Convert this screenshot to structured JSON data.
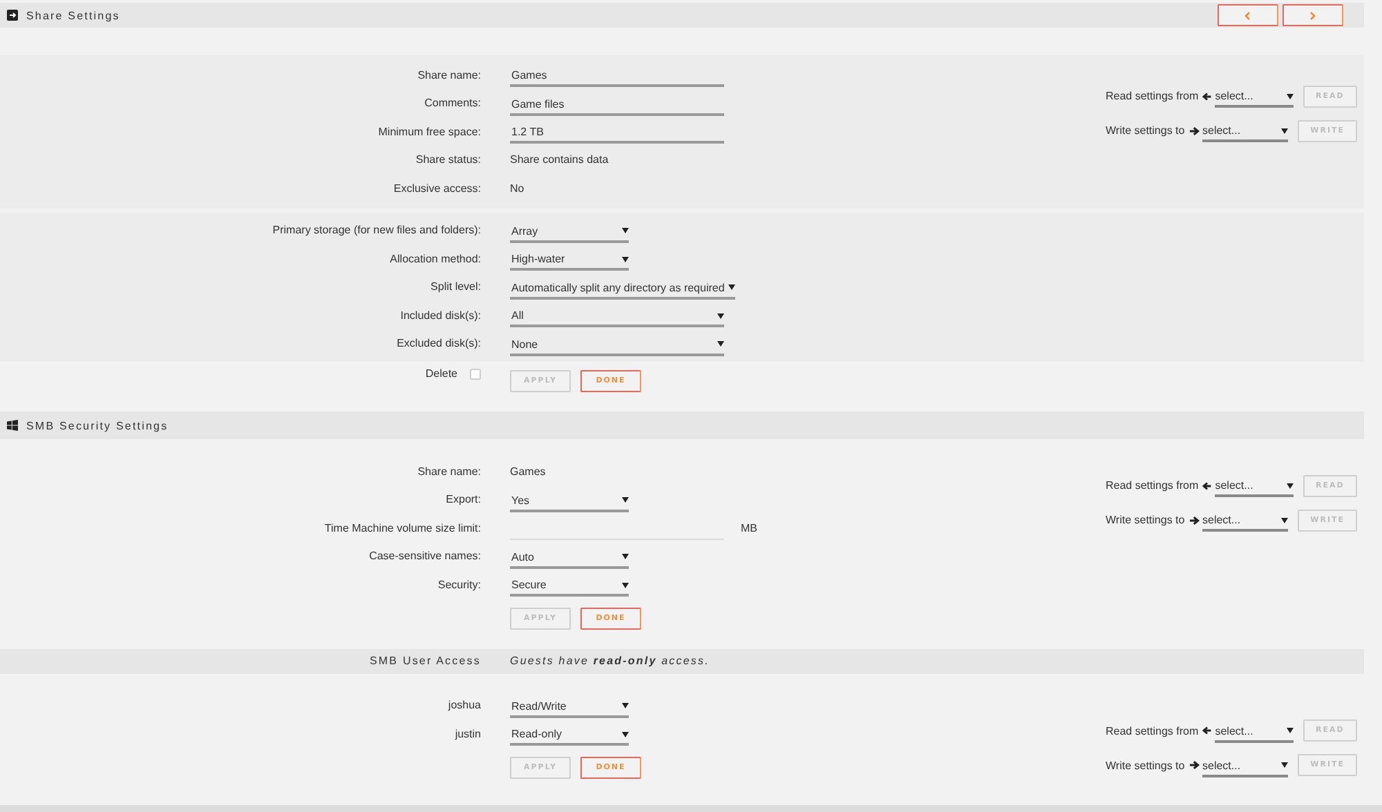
{
  "share_settings": {
    "title": "Share Settings",
    "navigation": true,
    "general": [
      {
        "label": "Share name:",
        "kind": "text",
        "value": "Games"
      },
      {
        "label": "Comments:",
        "kind": "text",
        "value": "Game files"
      },
      {
        "label": "Minimum free space:",
        "kind": "text",
        "value": "1.2 TB"
      },
      {
        "label": "Share status:",
        "kind": "static",
        "value": "Share contains data"
      },
      {
        "label": "Exclusive access:",
        "kind": "static",
        "value": "No"
      }
    ],
    "copy": {
      "read_label": "Read settings from",
      "read_select": "select...",
      "read_button": "READ",
      "write_label": "Write settings to",
      "write_select": "select...",
      "write_button": "WRITE",
      "disabled": true
    },
    "storage": [
      {
        "label": "Primary storage (for new files and folders):",
        "kind": "select",
        "value": "Array"
      },
      {
        "label": "Allocation method:",
        "kind": "select",
        "value": "High-water"
      },
      {
        "label": "Split level:",
        "kind": "longselect",
        "value": "Automatically split any directory as required"
      },
      {
        "label": "Included disk(s):",
        "kind": "longselect",
        "value": "All"
      },
      {
        "label": "Excluded disk(s):",
        "kind": "longselect",
        "value": "None"
      }
    ],
    "delete": {
      "label": "Delete",
      "checked": false
    },
    "buttons": [
      {
        "label": "APPLY",
        "disabled": true
      },
      {
        "label": "DONE",
        "disabled": false
      }
    ]
  },
  "smb_security": {
    "title": "SMB Security Settings",
    "rows": [
      {
        "label": "Share name:",
        "kind": "static",
        "value": "Games"
      },
      {
        "label": "Export:",
        "kind": "select",
        "value": "Yes"
      },
      {
        "label": "Time Machine volume size limit:",
        "kind": "unit",
        "unit": "MB"
      },
      {
        "label": "Case-sensitive names:",
        "kind": "select",
        "value": "Auto"
      },
      {
        "label": "Security:",
        "kind": "select",
        "value": "Secure"
      }
    ],
    "copy": {
      "read_label": "Read settings from",
      "read_select": "select...",
      "read_button": "READ",
      "write_label": "Write settings to",
      "write_select": "select...",
      "write_button": "WRITE",
      "disabled": true
    },
    "buttons": [
      {
        "label": "APPLY",
        "disabled": true
      },
      {
        "label": "DONE",
        "disabled": false
      }
    ]
  },
  "smb_user_access": {
    "title": "SMB User Access",
    "note": "Guests have **read-only** access.",
    "rows": [
      {
        "label": "joshua",
        "kind": "select",
        "value": "Read/Write"
      },
      {
        "label": "justin",
        "kind": "select",
        "value": "Read-only"
      }
    ],
    "copy": {
      "read_label": "Read settings from",
      "read_select": "select...",
      "read_button": "READ",
      "write_label": "Write settings to",
      "write_select": "select...",
      "write_button": "WRITE",
      "disabled": true
    },
    "buttons": [
      {
        "label": "APPLY",
        "disabled": true
      },
      {
        "label": "DONE",
        "disabled": false
      }
    ]
  }
}
